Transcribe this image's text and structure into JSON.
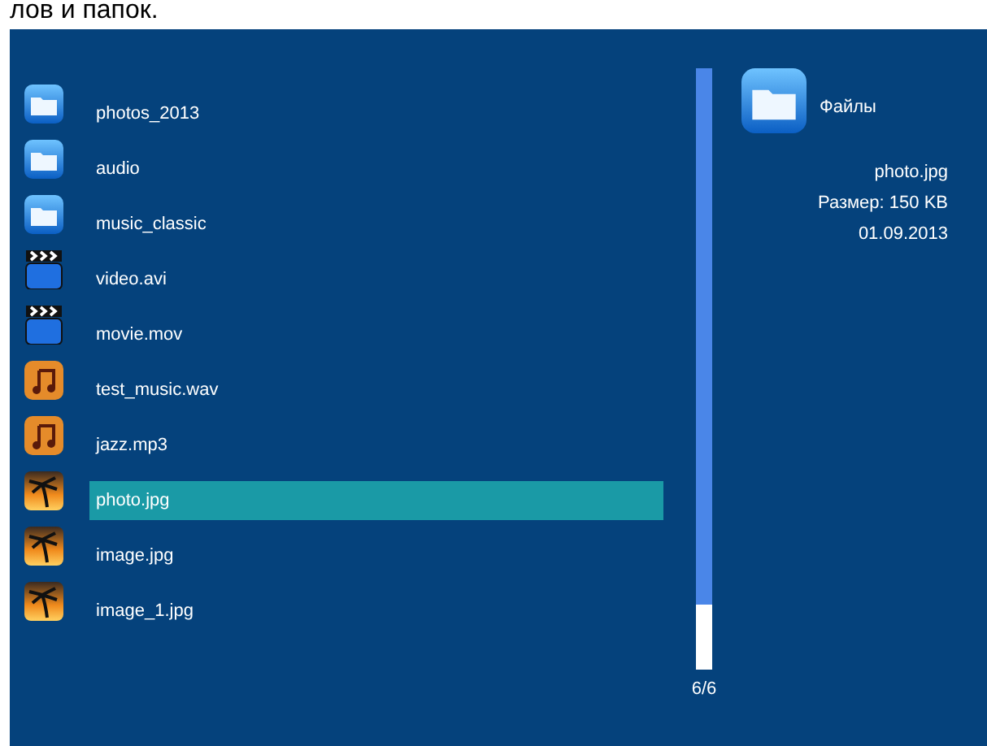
{
  "caption": "лов и папок.",
  "files": [
    {
      "name": "photos_2013",
      "kind": "folder",
      "selected": false
    },
    {
      "name": "audio",
      "kind": "folder",
      "selected": false
    },
    {
      "name": "music_classic",
      "kind": "folder",
      "selected": false
    },
    {
      "name": "video.avi",
      "kind": "video",
      "selected": false
    },
    {
      "name": "movie.mov",
      "kind": "video",
      "selected": false
    },
    {
      "name": "test_music.wav",
      "kind": "audio",
      "selected": false
    },
    {
      "name": "jazz.mp3",
      "kind": "audio",
      "selected": false
    },
    {
      "name": "photo.jpg",
      "kind": "image",
      "selected": true
    },
    {
      "name": "image.jpg",
      "kind": "image",
      "selected": false
    },
    {
      "name": "image_1.jpg",
      "kind": "image",
      "selected": false
    }
  ],
  "page": "6/6",
  "info": {
    "title": "Файлы",
    "filename": "photo.jpg",
    "size": "Размер: 150 KB",
    "date": "01.09.2013"
  }
}
